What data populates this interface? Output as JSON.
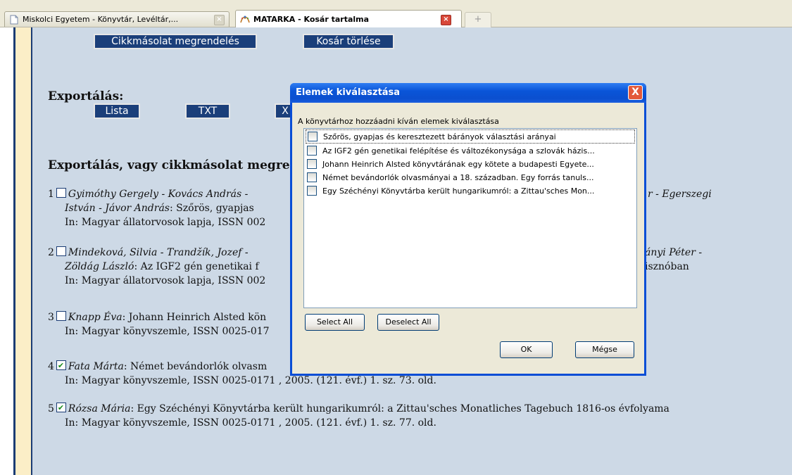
{
  "tabs": [
    {
      "label": "Miskolci Egyetem - Könyvtár, Levéltár,..."
    },
    {
      "label": "MATARKA - Kosár tartalma"
    }
  ],
  "new_tab_label": "+",
  "top_buttons": {
    "order_copy": "Cikkmásolat megrendelés",
    "clear_cart": "Kosár törlése"
  },
  "export": {
    "heading": "Exportálás:",
    "buttons": [
      "Lista",
      "TXT",
      "X"
    ]
  },
  "section_heading": "Exportálás, vagy cikkmásolat megre",
  "entries": [
    {
      "number": "1",
      "checked": false,
      "line1_authors": "Gyimóthy Gergely - Kovács András - ",
      "line1_right": "r - Egerszegi",
      "line2_authors": "István - Jávor András",
      "line2_text": ": Szőrös, gyapjas",
      "line3": "In: Magyar állatorvosok lapja, ISSN 002"
    },
    {
      "number": "2",
      "checked": false,
      "line1_authors": "Mindeková, Silvia - Trandžík, Jozef - ",
      "line1_right": "ányi Péter -",
      "line2_authors": "Zöldág László",
      "line2_text": ": Az IGF2 gén genetikai f",
      "line2_right": "isznóban",
      "line3": "In: Magyar állatorvosok lapja, ISSN 002"
    },
    {
      "number": "3",
      "checked": false,
      "line1_authors": "Knapp Éva",
      "line1_text": ": Johann Heinrich Alsted kön",
      "line2": "In: Magyar könyvszemle, ISSN 0025-017"
    },
    {
      "number": "4",
      "checked": true,
      "line1_authors": "Fata Márta",
      "line1_text": ": Német bevándorlók olvasm",
      "line2": "In: Magyar könyvszemle, ISSN 0025-0171 , 2005. (121. évf.) 1. sz. 73. old."
    },
    {
      "number": "5",
      "checked": true,
      "line1_authors": "Rózsa Mária",
      "line1_text": ": Egy Széchényi Könyvtárba került hungarikumról: a Zittau'sches Monatliches Tagebuch 1816-os évfolyama",
      "line2": "In: Magyar könyvszemle, ISSN 0025-0171 , 2005. (121. évf.) 1. sz. 77. old."
    }
  ],
  "dialog": {
    "title": "Elemek kiválasztása",
    "close": "X",
    "caption": "A könyvtárhoz hozzáadni kíván elemek kiválasztása",
    "items": [
      "Szőrös, gyapjas és keresztezett bárányok választási arányai",
      "Az IGF2 gén genetikai felépítése és változékonysága a szlovák házis...",
      "Johann Heinrich Alsted könyvtárának egy kötete a budapesti Egyete...",
      "Német bevándorlók olvasmányai a 18. században. Egy forrás tanuls...",
      "Egy Széchényi Könyvtárba került hungarikumról: a Zittau'sches Mon..."
    ],
    "select_all": "Select All",
    "deselect_all": "Deselect All",
    "ok": "OK",
    "cancel": "Mégse"
  }
}
